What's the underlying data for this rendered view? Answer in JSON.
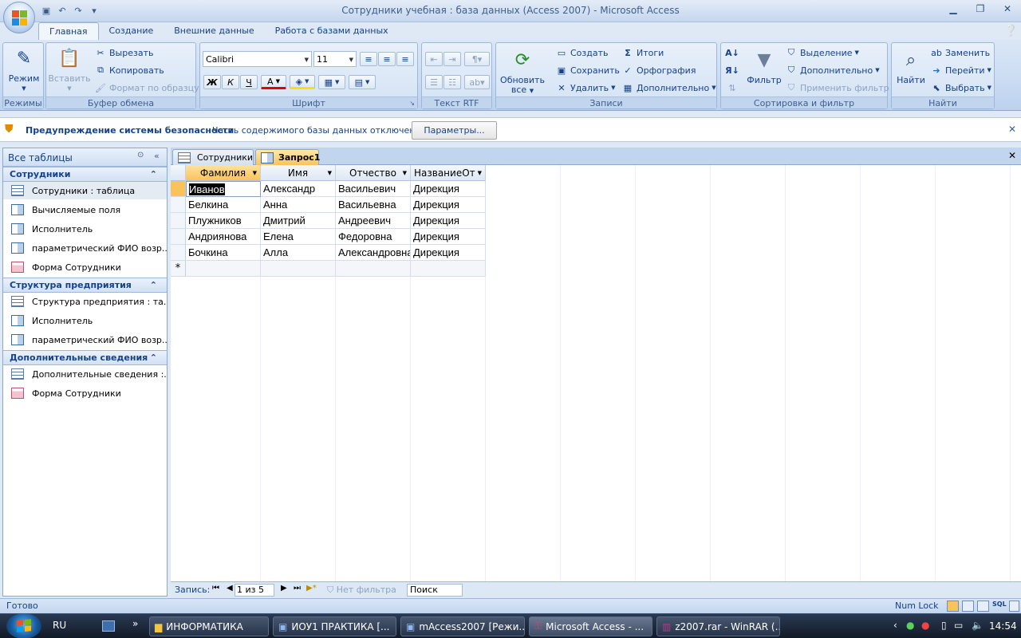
{
  "window": {
    "title": "Сотрудники учебная : база данных (Access 2007) - Microsoft Access"
  },
  "ribbon_tabs": [
    {
      "label": "Главная",
      "active": true
    },
    {
      "label": "Создание"
    },
    {
      "label": "Внешние данные"
    },
    {
      "label": "Работа с базами данных"
    }
  ],
  "ribbon": {
    "views": {
      "label": "Режимы",
      "btn": "Режим"
    },
    "clipboard": {
      "label": "Буфер обмена",
      "paste": "Вставить",
      "cut": "Вырезать",
      "copy": "Копировать",
      "format_painter": "Формат по образцу"
    },
    "font": {
      "label": "Шрифт",
      "family": "Calibri",
      "size": "11",
      "bold": "Ж",
      "italic": "К",
      "underline": "Ч",
      "color_letter": "A"
    },
    "rtf": {
      "label": "Текст RTF"
    },
    "records": {
      "label": "Записи",
      "refresh_line1": "Обновить",
      "refresh_line2": "все",
      "new": "Создать",
      "save": "Сохранить",
      "delete": "Удалить",
      "totals": "Итоги",
      "spelling": "Орфография",
      "more": "Дополнительно"
    },
    "sort": {
      "label": "Сортировка и фильтр",
      "filter": "Фильтр",
      "selection": "Выделение",
      "advanced": "Дополнительно",
      "apply": "Применить фильтр"
    },
    "find": {
      "label": "Найти",
      "find": "Найти",
      "replace": "Заменить",
      "goto": "Перейти",
      "select": "Выбрать"
    }
  },
  "security_bar": {
    "title": "Предупреждение системы безопасности",
    "message": "Часть содержимого базы данных отключено",
    "button": "Параметры..."
  },
  "nav": {
    "header": "Все таблицы",
    "groups": [
      {
        "name": "Сотрудники",
        "items": [
          {
            "label": "Сотрудники : таблица",
            "type": "table",
            "selected": true
          },
          {
            "label": "Вычисляемые поля",
            "type": "query"
          },
          {
            "label": "Исполнитель",
            "type": "query"
          },
          {
            "label": "параметрический ФИО возр...",
            "type": "query"
          },
          {
            "label": "Форма Сотрудники",
            "type": "form"
          }
        ]
      },
      {
        "name": "Структура предприятия",
        "items": [
          {
            "label": "Структура предприятия : та...",
            "type": "table"
          },
          {
            "label": "Исполнитель",
            "type": "query"
          },
          {
            "label": "параметрический ФИО возр...",
            "type": "query"
          }
        ]
      },
      {
        "name": "Дополнительные сведения",
        "items": [
          {
            "label": "Дополнительные сведения :...",
            "type": "table"
          },
          {
            "label": "Форма Сотрудники",
            "type": "form"
          }
        ]
      }
    ]
  },
  "doc_tabs": [
    {
      "label": "Сотрудники",
      "type": "table"
    },
    {
      "label": "Запрос1",
      "type": "query",
      "active": true
    }
  ],
  "grid": {
    "columns": [
      "Фамилия",
      "Имя",
      "Отчество",
      "НазваниеОт"
    ],
    "rows": [
      [
        "Иванов",
        "Александр",
        "Васильевич",
        "Дирекция"
      ],
      [
        "Белкина",
        "Анна",
        "Васильевна",
        "Дирекция"
      ],
      [
        "Плужников",
        "Дмитрий",
        "Андреевич",
        "Дирекция"
      ],
      [
        "Андриянова",
        "Елена",
        "Федоровна",
        "Дирекция"
      ],
      [
        "Бочкина",
        "Алла",
        "Александровна",
        "Дирекция"
      ]
    ],
    "new_row_marker": "*"
  },
  "record_nav": {
    "label": "Запись:",
    "position": "1 из 5",
    "filter": "Нет фильтра",
    "search": "Поиск"
  },
  "status": {
    "left": "Готово",
    "numlock": "Num Lock",
    "sql": "SQL"
  },
  "taskbar": {
    "lang": "RU",
    "items": [
      {
        "label": "ИНФОРМАТИКА"
      },
      {
        "label": "ИОУ1 ПРАКТИКА [..."
      },
      {
        "label": "mAccess2007 [Режи..."
      },
      {
        "label": "Microsoft Access - ...",
        "active": true
      },
      {
        "label": "z2007.rar - WinRAR (..."
      }
    ],
    "clock": "14:54"
  },
  "colors": {
    "ribbon": "#c7d9f1",
    "accent": "#15428b",
    "active_tab": "#f9c35b"
  }
}
